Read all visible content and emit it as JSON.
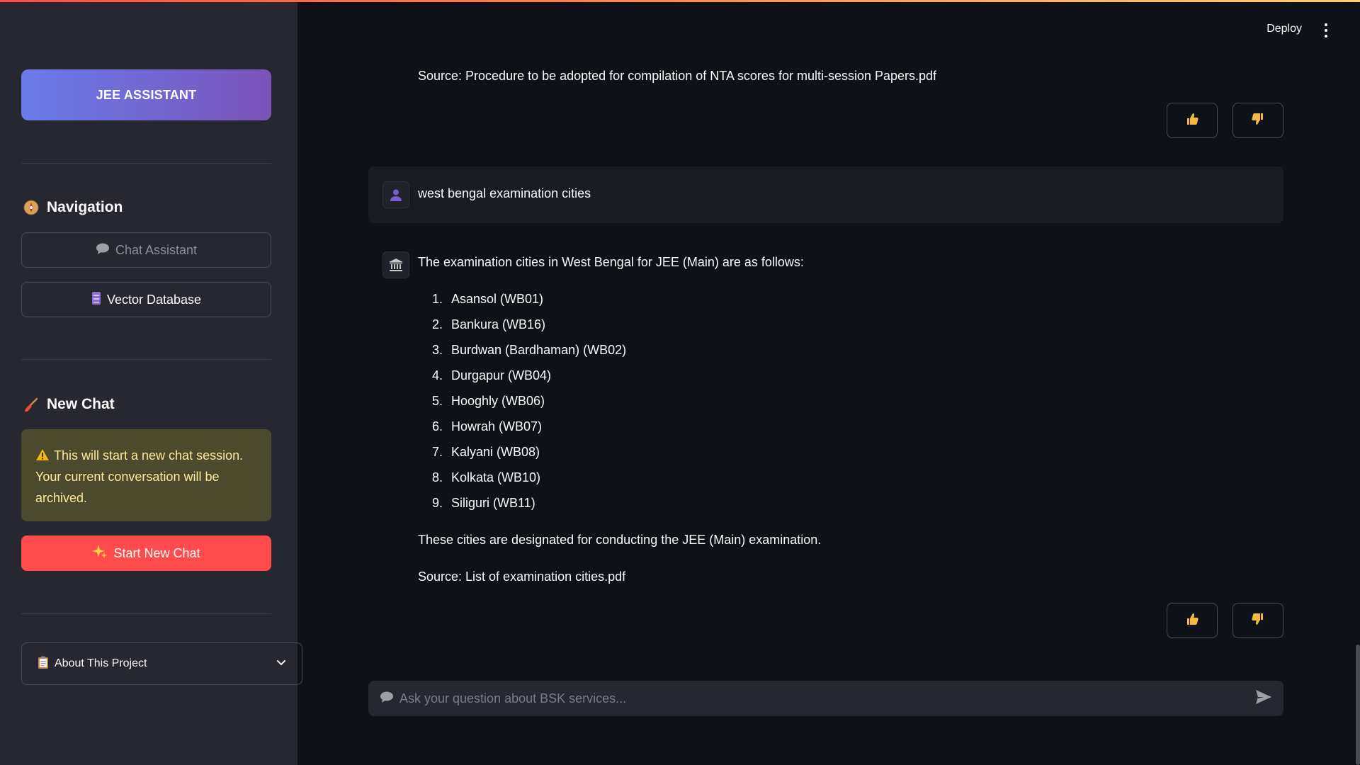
{
  "sidebar": {
    "brand_label": "JEE ASSISTANT",
    "navigation_heading": "Navigation",
    "nav_items": [
      {
        "label": "Chat Assistant",
        "icon": "speech-bubble-icon",
        "state": "disabled"
      },
      {
        "label": "Vector Database",
        "icon": "database-icon",
        "state": "active"
      }
    ],
    "new_chat_heading": "New Chat",
    "warning_text": "This will start a new chat session. Your current conversation will be archived.",
    "start_new_chat_label": "Start New Chat",
    "about_label": "About This Project"
  },
  "header": {
    "deploy_label": "Deploy"
  },
  "chat": {
    "previous_source": "Source: Procedure to be adopted for compilation of NTA scores for multi-session Papers.pdf",
    "user_message": "west bengal examination cities",
    "assistant_intro": "The examination cities in West Bengal for JEE (Main) are as follows:",
    "cities": [
      "Asansol (WB01)",
      "Bankura (WB16)",
      "Burdwan (Bardhaman) (WB02)",
      "Durgapur (WB04)",
      "Hooghly (WB06)",
      "Howrah (WB07)",
      "Kalyani (WB08)",
      "Kolkata (WB10)",
      "Siliguri (WB11)"
    ],
    "city_numbers": [
      "1.",
      "2.",
      "3.",
      "4.",
      "5.",
      "6.",
      "7.",
      "8.",
      "9."
    ],
    "assistant_outro": "These cities are designated for conducting the JEE (Main) examination.",
    "assistant_source": "Source: List of examination cities.pdf"
  },
  "input": {
    "placeholder": "Ask your question about BSK services..."
  },
  "colors": {
    "accent_red": "#ff4b4b",
    "brand_gradient_start": "#6a7bea",
    "brand_gradient_end": "#7b54ba",
    "warning_bg": "#4b4a2c",
    "warning_text": "#ffe89a"
  }
}
